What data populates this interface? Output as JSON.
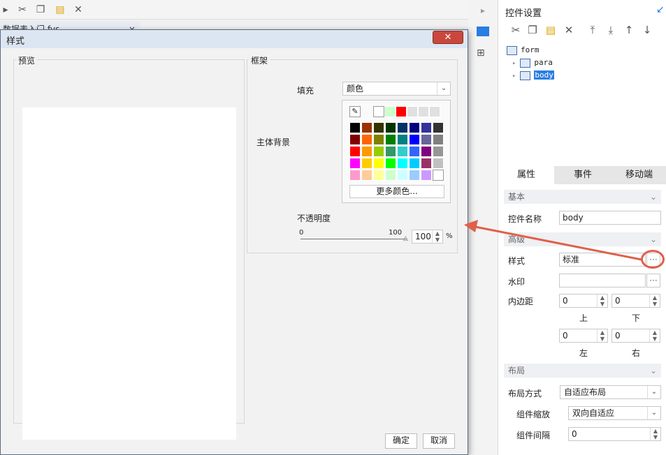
{
  "background": {
    "tab_label": "数据表入门.fvs",
    "tab_close": "×"
  },
  "right_panel": {
    "title": "控件设置",
    "tree": [
      "form",
      "para",
      "body"
    ],
    "tabs": [
      "属性",
      "事件",
      "移动端"
    ],
    "sections": {
      "basic": "基本",
      "advanced": "高级",
      "layout": "布局"
    },
    "props": {
      "name_label": "控件名称",
      "name_value": "body",
      "style_label": "样式",
      "style_value": "标准",
      "watermark_label": "水印",
      "watermark_value": "",
      "padding_label": "内边距",
      "padding_top": "0",
      "padding_bottom": "0",
      "padding_left": "0",
      "padding_right": "0",
      "top_label": "上",
      "bottom_label": "下",
      "left_label": "左",
      "right_label": "右",
      "layout_mode_label": "布局方式",
      "layout_mode_value": "自适应布局",
      "scale_label": "组件缩放",
      "scale_value": "双向自适应",
      "gap_label": "组件间隔",
      "gap_value": "0"
    },
    "ellipsis": "···"
  },
  "dialog": {
    "title": "样式",
    "close": "✕",
    "preview_label": "预览",
    "frame_label": "框架",
    "fill_label": "填充",
    "fill_value": "颜色",
    "body_bg_label": "主体背景",
    "more_colors": "更多颜色...",
    "opacity_label": "不透明度",
    "slider_min": "0",
    "slider_max": "100",
    "opacity_value": "100",
    "opacity_unit": "%",
    "ok": "确定",
    "cancel": "取消"
  },
  "palette": {
    "recent": [
      "#ffffff",
      "#ccffcc",
      "#ff0000",
      "#e0e0e0",
      "#e0e0e0",
      "#e0e0e0"
    ],
    "rows": [
      [
        "#000000",
        "#993300",
        "#333300",
        "#003300",
        "#003366",
        "#000080",
        "#333399",
        "#333333"
      ],
      [
        "#800000",
        "#ff6600",
        "#808000",
        "#008000",
        "#008080",
        "#0000ff",
        "#666699",
        "#808080"
      ],
      [
        "#ff0000",
        "#ff9900",
        "#99cc00",
        "#339966",
        "#33cccc",
        "#3366ff",
        "#800080",
        "#969696"
      ],
      [
        "#ff00ff",
        "#ffcc00",
        "#ffff00",
        "#00ff00",
        "#00ffff",
        "#00ccff",
        "#993366",
        "#c0c0c0"
      ],
      [
        "#ff99cc",
        "#ffcc99",
        "#ffff99",
        "#ccffcc",
        "#ccffff",
        "#99ccff",
        "#cc99ff",
        "#ffffff"
      ]
    ]
  },
  "colors": {
    "arrow": "#e0604a",
    "highlight": "#e0604a",
    "selection": "#2a7de1"
  }
}
